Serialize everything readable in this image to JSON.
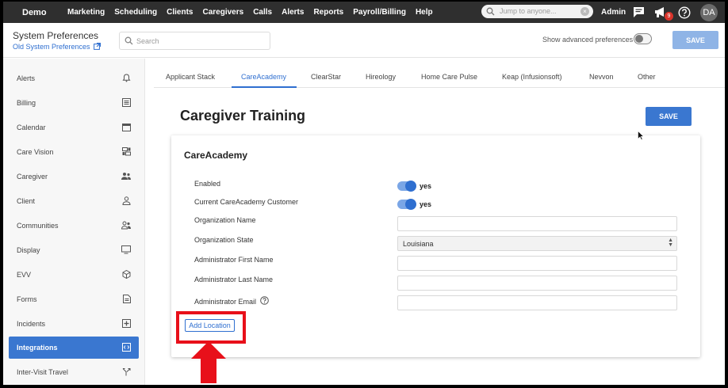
{
  "topnav": {
    "brand": "Demo",
    "items": [
      "Marketing",
      "Scheduling",
      "Clients",
      "Caregivers",
      "Calls",
      "Alerts",
      "Reports",
      "Payroll/Billing",
      "Help"
    ],
    "jump_placeholder": "Jump to anyone...",
    "admin": "Admin",
    "notification_count": "9",
    "avatar_initials": "DA"
  },
  "header": {
    "title": "System Preferences",
    "old_link": "Old System Preferences",
    "search_placeholder": "Search",
    "advanced_label": "Show advanced preferences",
    "save_label": "SAVE"
  },
  "sidebar": {
    "items": [
      {
        "label": "Alerts",
        "icon": "bell-icon"
      },
      {
        "label": "Billing",
        "icon": "list-icon"
      },
      {
        "label": "Calendar",
        "icon": "calendar-icon"
      },
      {
        "label": "Care Vision",
        "icon": "dashboard-icon"
      },
      {
        "label": "Caregiver",
        "icon": "people-icon"
      },
      {
        "label": "Client",
        "icon": "person-icon"
      },
      {
        "label": "Communities",
        "icon": "group-icon"
      },
      {
        "label": "Display",
        "icon": "monitor-icon"
      },
      {
        "label": "EVV",
        "icon": "cube-icon"
      },
      {
        "label": "Forms",
        "icon": "document-icon"
      },
      {
        "label": "Incidents",
        "icon": "plus-box-icon"
      },
      {
        "label": "Integrations",
        "icon": "code-icon",
        "active": true
      },
      {
        "label": "Inter-Visit Travel",
        "icon": "route-icon"
      }
    ]
  },
  "tabs": [
    "Applicant Stack",
    "CareAcademy",
    "ClearStar",
    "Hireology",
    "Home Care Pulse",
    "Keap (Infusionsoft)",
    "Nevvon",
    "Other"
  ],
  "active_tab": "CareAcademy",
  "main": {
    "page_title": "Caregiver Training",
    "save_label": "SAVE",
    "card_title": "CareAcademy",
    "fields": {
      "enabled_label": "Enabled",
      "enabled_value": "yes",
      "customer_label": "Current CareAcademy Customer",
      "customer_value": "yes",
      "org_name_label": "Organization Name",
      "org_name_value": "",
      "org_state_label": "Organization State",
      "org_state_value": "Louisiana",
      "admin_first_label": "Administrator First Name",
      "admin_first_value": "",
      "admin_last_label": "Administrator Last Name",
      "admin_last_value": "",
      "admin_email_label": "Administrator Email",
      "admin_email_value": ""
    },
    "add_location_label": "Add Location"
  },
  "colors": {
    "topnav_bg": "#2f2f2f",
    "accent": "#3a77d0",
    "highlight": "#e8101a"
  }
}
